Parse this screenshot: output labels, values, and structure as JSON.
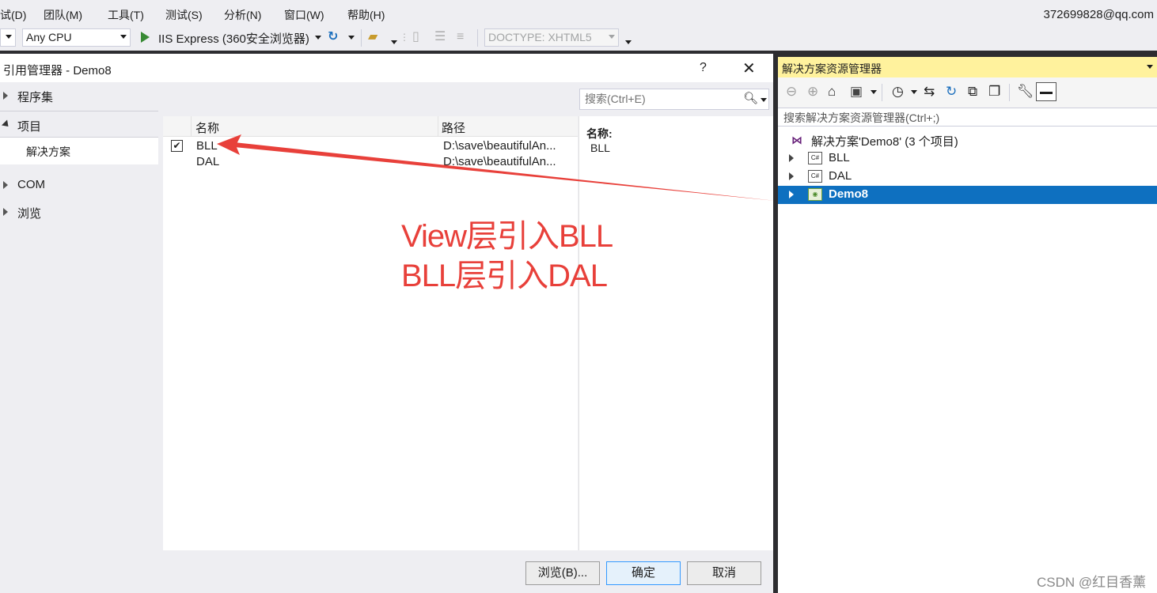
{
  "menu": {
    "items": [
      "试(D)",
      "团队(M)",
      "工具(T)",
      "测试(S)",
      "分析(N)",
      "窗口(W)",
      "帮助(H)"
    ],
    "account": "372699828@qq.com"
  },
  "toolbar": {
    "platform": "Any CPU",
    "run_target": "IIS Express (360安全浏览器)",
    "doctype": "DOCTYPE: XHTML5"
  },
  "dialog": {
    "title": "引用管理器 - Demo8",
    "help": "?",
    "close": "✕",
    "nav": {
      "assemblies": "程序集",
      "projects": "项目",
      "solution": "解决方案",
      "com": "COM",
      "browse": "浏览"
    },
    "search_placeholder": "搜索(Ctrl+E)",
    "columns": {
      "name": "名称",
      "path": "路径"
    },
    "rows": [
      {
        "checked": "✔",
        "name": "BLL",
        "path": "D:\\save\\beautifulAn..."
      },
      {
        "checked": "",
        "name": "DAL",
        "path": "D:\\save\\beautifulAn..."
      }
    ],
    "details": {
      "label": "名称:",
      "value": "BLL"
    },
    "buttons": {
      "browse": "浏览(B)...",
      "ok": "确定",
      "cancel": "取消"
    }
  },
  "annotation": {
    "line1": "View层引入BLL",
    "line2": "BLL层引入DAL",
    "color": "#e8403a"
  },
  "solution_explorer": {
    "title": "解决方案资源管理器",
    "search_placeholder": "搜索解决方案资源管理器(Ctrl+;)",
    "root": "解决方案'Demo8' (3 个项目)",
    "projects": [
      {
        "name": "BLL",
        "icon": "C#"
      },
      {
        "name": "DAL",
        "icon": "C#"
      },
      {
        "name": "Demo8",
        "icon": "web",
        "selected": true
      }
    ]
  },
  "watermark": "CSDN @红目香薰"
}
